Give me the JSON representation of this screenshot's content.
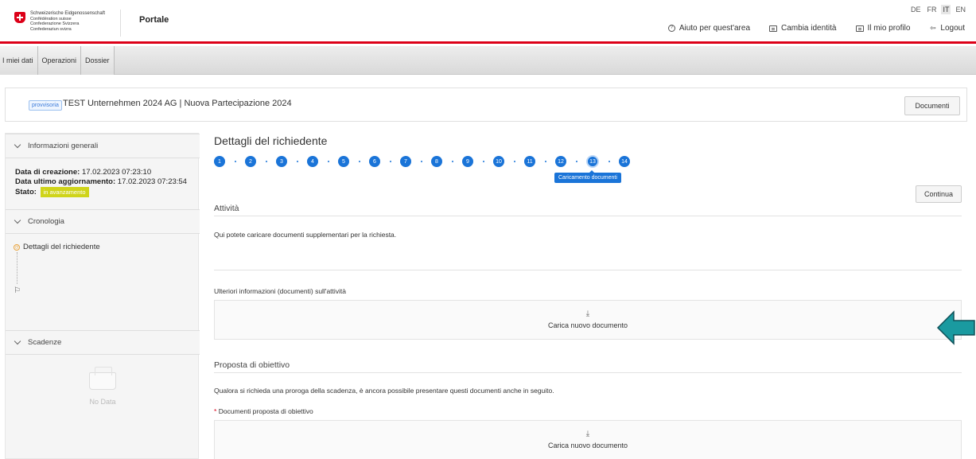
{
  "header": {
    "logo_lines": [
      "Schweizerische Eidgenossenschaft",
      "Confédération suisse",
      "Confederazione Svizzera",
      "Confederaziun svizra"
    ],
    "portal_title": "Portale",
    "languages": [
      "DE",
      "FR",
      "IT",
      "EN"
    ],
    "active_language": "IT",
    "nav": {
      "help": "Aiuto per quest'area",
      "switch_identity": "Cambia identità",
      "profile": "Il mio profilo",
      "logout": "Logout"
    }
  },
  "navbar": {
    "tabs": [
      "I miei dati",
      "Operazioni",
      "Dossier"
    ]
  },
  "case": {
    "badge": "provvisoria",
    "title": "TEST Unternehmen 2024 AG | Nuova Partecipazione 2024",
    "documents_button": "Documenti"
  },
  "sidebar": {
    "general_info": {
      "heading": "Informazioni generali",
      "created_label": "Data di creazione:",
      "created_value": "17.02.2023 07:23:10",
      "updated_label": "Data ultimo aggiornamento:",
      "updated_value": "17.02.2023 07:23:54",
      "status_label": "Stato:",
      "status_value": "in avanzamento"
    },
    "chronology": {
      "heading": "Cronologia",
      "items": [
        "Dettagli del richiedente"
      ]
    },
    "deadlines": {
      "heading": "Scadenze",
      "empty_text": "No Data"
    }
  },
  "main": {
    "title": "Dettagli del richiedente",
    "steps": [
      "1",
      "2",
      "3",
      "4",
      "5",
      "6",
      "7",
      "8",
      "9",
      "10",
      "11",
      "12",
      "13",
      "14"
    ],
    "active_step_tooltip": "Caricamento documenti",
    "continue_button": "Continua",
    "activity": {
      "heading": "Attività",
      "description": "Qui potete caricare documenti supplementari per la richiesta.",
      "docs_label": "Ulteriori informazioni (documenti) sull'attività",
      "upload_label": "Carica nuovo documento"
    },
    "proposal": {
      "heading": "Proposta di obiettivo",
      "description": "Qualora si richieda una proroga della scadenza, è ancora possibile presentare questi documenti anche in seguito.",
      "required_marker": "*",
      "docs_label": "Documenti proposta di obiettivo",
      "upload_label": "Carica nuovo documento"
    }
  },
  "colors": {
    "brand_red": "#dc0018",
    "primary_blue": "#1a74d8",
    "status_yellow": "#cfd41a",
    "annotation_arrow": "#1a9aa0"
  }
}
